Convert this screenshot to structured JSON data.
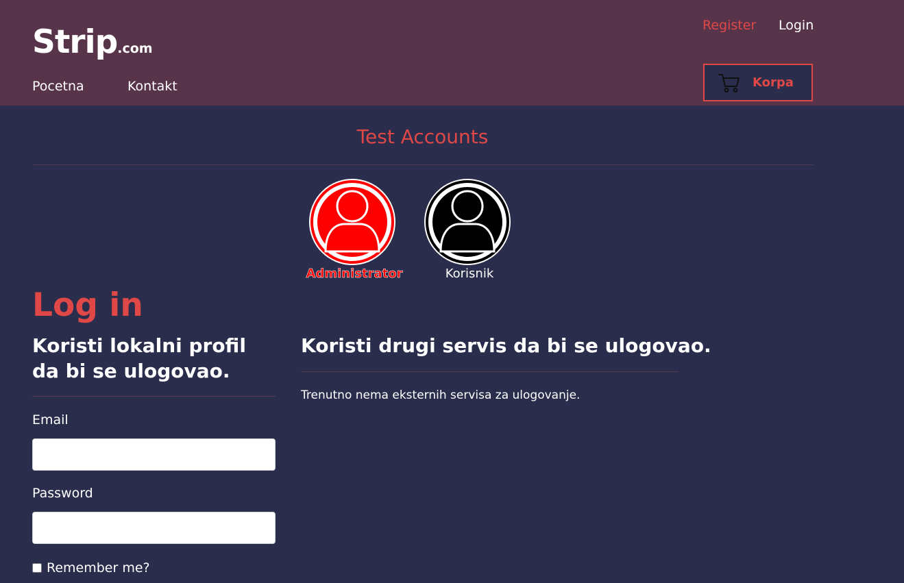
{
  "header": {
    "logo_main": "Strip",
    "logo_tld": ".com",
    "nav": {
      "home": "Pocetna",
      "contact": "Kontakt"
    },
    "register": "Register",
    "login": "Login",
    "cart_label": "Korpa",
    "cart_icon": "cart-icon"
  },
  "test_accounts": {
    "title": "Test Accounts",
    "admin_label": "Administrator",
    "user_label": "Korisnik",
    "admin_icon": "user-avatar-icon",
    "user_icon": "user-avatar-icon"
  },
  "login": {
    "title": "Log in",
    "local_subtitle": "Koristi lokalni profil da bi se ulogovao.",
    "email_label": "Email",
    "email_value": "",
    "password_label": "Password",
    "password_value": "",
    "remember_label": "Remember me?",
    "remember_checked": false,
    "external_subtitle": "Koristi drugi servis da bi se ulogovao.",
    "external_text": "Trenutno nema eksternih servisa za ulogovanje."
  },
  "colors": {
    "header_bg": "#57344a",
    "page_bg": "#2a2d4b",
    "accent": "#e04848",
    "admin_red": "#ff0000"
  }
}
